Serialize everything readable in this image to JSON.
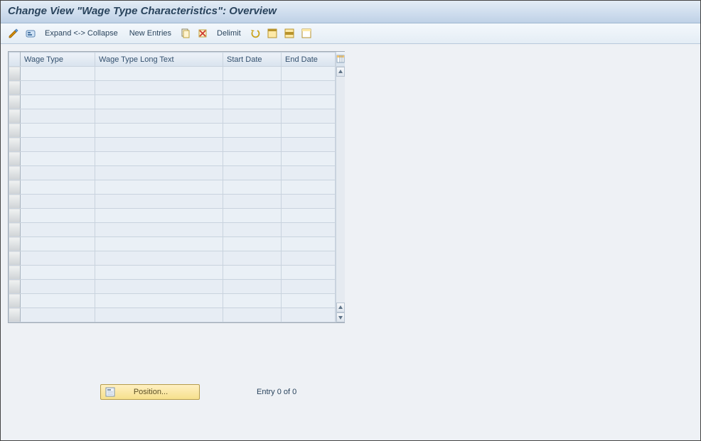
{
  "title": "Change View \"Wage Type Characteristics\": Overview",
  "toolbar": {
    "expand_label": "Expand <-> Collapse",
    "new_entries_label": "New Entries",
    "delimit_label": "Delimit"
  },
  "grid": {
    "columns": {
      "wage_type": "Wage Type",
      "wage_type_long_text": "Wage Type Long Text",
      "start_date": "Start Date",
      "end_date": "End Date"
    },
    "rows": [
      {
        "wage_type": "",
        "long_text": "",
        "start_date": "",
        "end_date": ""
      },
      {
        "wage_type": "",
        "long_text": "",
        "start_date": "",
        "end_date": ""
      },
      {
        "wage_type": "",
        "long_text": "",
        "start_date": "",
        "end_date": ""
      },
      {
        "wage_type": "",
        "long_text": "",
        "start_date": "",
        "end_date": ""
      },
      {
        "wage_type": "",
        "long_text": "",
        "start_date": "",
        "end_date": ""
      },
      {
        "wage_type": "",
        "long_text": "",
        "start_date": "",
        "end_date": ""
      },
      {
        "wage_type": "",
        "long_text": "",
        "start_date": "",
        "end_date": ""
      },
      {
        "wage_type": "",
        "long_text": "",
        "start_date": "",
        "end_date": ""
      },
      {
        "wage_type": "",
        "long_text": "",
        "start_date": "",
        "end_date": ""
      },
      {
        "wage_type": "",
        "long_text": "",
        "start_date": "",
        "end_date": ""
      },
      {
        "wage_type": "",
        "long_text": "",
        "start_date": "",
        "end_date": ""
      },
      {
        "wage_type": "",
        "long_text": "",
        "start_date": "",
        "end_date": ""
      },
      {
        "wage_type": "",
        "long_text": "",
        "start_date": "",
        "end_date": ""
      },
      {
        "wage_type": "",
        "long_text": "",
        "start_date": "",
        "end_date": ""
      },
      {
        "wage_type": "",
        "long_text": "",
        "start_date": "",
        "end_date": ""
      },
      {
        "wage_type": "",
        "long_text": "",
        "start_date": "",
        "end_date": ""
      },
      {
        "wage_type": "",
        "long_text": "",
        "start_date": "",
        "end_date": ""
      },
      {
        "wage_type": "",
        "long_text": "",
        "start_date": "",
        "end_date": ""
      }
    ]
  },
  "footer": {
    "position_label": "Position...",
    "entry_text": "Entry 0 of 0"
  },
  "icons": {
    "change": "change-icon",
    "selection": "selection-criteria-icon",
    "copy": "copy-icon",
    "delete": "delete-icon",
    "undo": "undo-icon",
    "select_all": "select-all-icon",
    "select_block": "select-block-icon",
    "deselect_all": "deselect-all-icon",
    "config": "table-settings-icon",
    "form": "form-icon"
  }
}
